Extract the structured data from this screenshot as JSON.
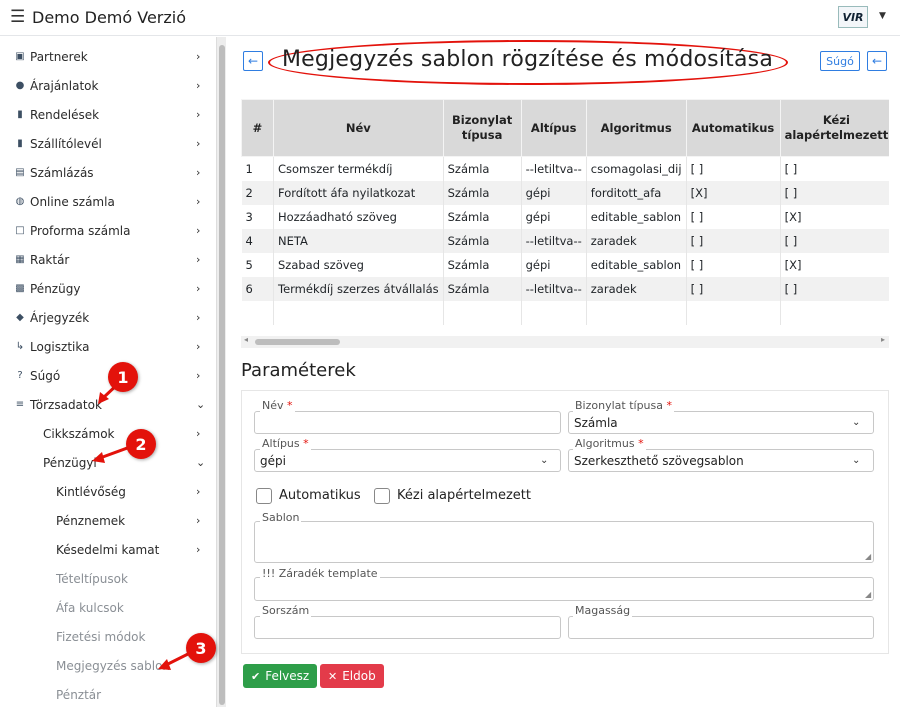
{
  "app": {
    "title": "Demo Demó Verzió",
    "logo_text": "VIR"
  },
  "sidebar": {
    "items": [
      {
        "label": "Partnerek",
        "icon": "id-card-icon",
        "glyph": "▣",
        "level": 0,
        "chevron": "›"
      },
      {
        "label": "Árajánlatok",
        "icon": "users-icon",
        "glyph": "●",
        "level": 0,
        "chevron": "›"
      },
      {
        "label": "Rendelések",
        "icon": "file-icon",
        "glyph": "▮",
        "level": 0,
        "chevron": "›"
      },
      {
        "label": "Szállítólevél",
        "icon": "clipboard-icon",
        "glyph": "▮",
        "level": 0,
        "chevron": "›"
      },
      {
        "label": "Számlázás",
        "icon": "invoice-icon",
        "glyph": "▤",
        "level": 0,
        "chevron": "›"
      },
      {
        "label": "Online számla",
        "icon": "globe-icon",
        "glyph": "◍",
        "level": 0,
        "chevron": "›"
      },
      {
        "label": "Proforma számla",
        "icon": "square-icon",
        "glyph": "□",
        "level": 0,
        "chevron": "›"
      },
      {
        "label": "Raktár",
        "icon": "warehouse-icon",
        "glyph": "▦",
        "level": 0,
        "chevron": "›"
      },
      {
        "label": "Pénzügy",
        "icon": "money-icon",
        "glyph": "▩",
        "level": 0,
        "chevron": "›"
      },
      {
        "label": "Árjegyzék",
        "icon": "tags-icon",
        "glyph": "◆",
        "level": 0,
        "chevron": "›"
      },
      {
        "label": "Logisztika",
        "icon": "dolly-icon",
        "glyph": "↳",
        "level": 0,
        "chevron": "›"
      },
      {
        "label": "Súgó",
        "icon": "question-icon",
        "glyph": "?",
        "level": 0,
        "chevron": "›"
      },
      {
        "label": "Törzsadatok",
        "icon": "database-icon",
        "glyph": "≡",
        "level": 0,
        "chevron": "⌄"
      },
      {
        "label": "Cikkszámok",
        "icon": "",
        "glyph": "",
        "level": 1,
        "chevron": "›"
      },
      {
        "label": "Pénzügyi",
        "icon": "",
        "glyph": "",
        "level": 1,
        "chevron": "⌄"
      },
      {
        "label": "Kintlévőség",
        "icon": "",
        "glyph": "",
        "level": 2,
        "chevron": "›"
      },
      {
        "label": "Pénznemek",
        "icon": "",
        "glyph": "",
        "level": 2,
        "chevron": "›"
      },
      {
        "label": "Késedelmi kamat",
        "icon": "",
        "glyph": "",
        "level": 2,
        "chevron": "›"
      },
      {
        "label": "Tételtípusok",
        "icon": "",
        "glyph": "",
        "level": 2,
        "chevron": "",
        "muted": true
      },
      {
        "label": "Áfa kulcsok",
        "icon": "",
        "glyph": "",
        "level": 2,
        "chevron": "",
        "muted": true
      },
      {
        "label": "Fizetési módok",
        "icon": "",
        "glyph": "",
        "level": 2,
        "chevron": "",
        "muted": true
      },
      {
        "label": "Megjegyzés sablon",
        "icon": "",
        "glyph": "",
        "level": 2,
        "chevron": "",
        "muted": true
      },
      {
        "label": "Pénztár",
        "icon": "",
        "glyph": "",
        "level": 2,
        "chevron": "",
        "muted": true
      }
    ]
  },
  "annotations": {
    "m1": "1",
    "m2": "2",
    "m3": "3",
    "color": "#e3120b"
  },
  "header": {
    "back_glyph": "←",
    "title": "Megjegyzés sablon rögzítése és módosítása",
    "help_label": "Súgó"
  },
  "table": {
    "columns": [
      "#",
      "Név",
      "Bizonylat típusa",
      "Altípus",
      "Algoritmus",
      "Automatikus",
      "Kézi alapértelmezett",
      ""
    ],
    "rows": [
      [
        "1",
        "Csomszer termékdíj",
        "Számla",
        "--letiltva--",
        "csomagolasi_dij",
        "[ ]",
        "[ ]",
        ""
      ],
      [
        "2",
        "Fordított áfa nyilatkozat",
        "Számla",
        "gépi",
        "forditott_afa",
        "[X]",
        "[ ]",
        "I"
      ],
      [
        "3",
        "Hozzáadható szöveg",
        "Számla",
        "gépi",
        "editable_sablon",
        "[ ]",
        "[X]",
        ""
      ],
      [
        "4",
        "NETA",
        "Számla",
        "--letiltva--",
        "zaradek",
        "[ ]",
        "[ ]",
        "a"
      ],
      [
        "5",
        "Szabad szöveg",
        "Számla",
        "gépi",
        "editable_sablon",
        "[ ]",
        "[X]",
        "A"
      ],
      [
        "6",
        "Termékdíj szerzes átvállalás",
        "Számla",
        "--letiltva--",
        "zaradek",
        "[ ]",
        "[ ]",
        "a"
      ]
    ]
  },
  "params": {
    "title": "Paraméterek",
    "nev": {
      "label": "Név",
      "value": ""
    },
    "bizonylat": {
      "label": "Bizonylat típusa",
      "value": "Számla"
    },
    "altipus": {
      "label": "Altípus",
      "value": "gépi"
    },
    "algoritmus": {
      "label": "Algoritmus",
      "value": "Szerkeszthető szövegsablon"
    },
    "automatikus": "Automatikus",
    "kezi": "Kézi alapértelmezett",
    "sablon": "Sablon",
    "zaradek": "!!! Záradék template",
    "sorszam": "Sorszám",
    "magassag": "Magasság",
    "required_mark": "*"
  },
  "buttons": {
    "save": "Felvesz",
    "discard": "Eldob",
    "save_glyph": "✔",
    "discard_glyph": "✕"
  }
}
